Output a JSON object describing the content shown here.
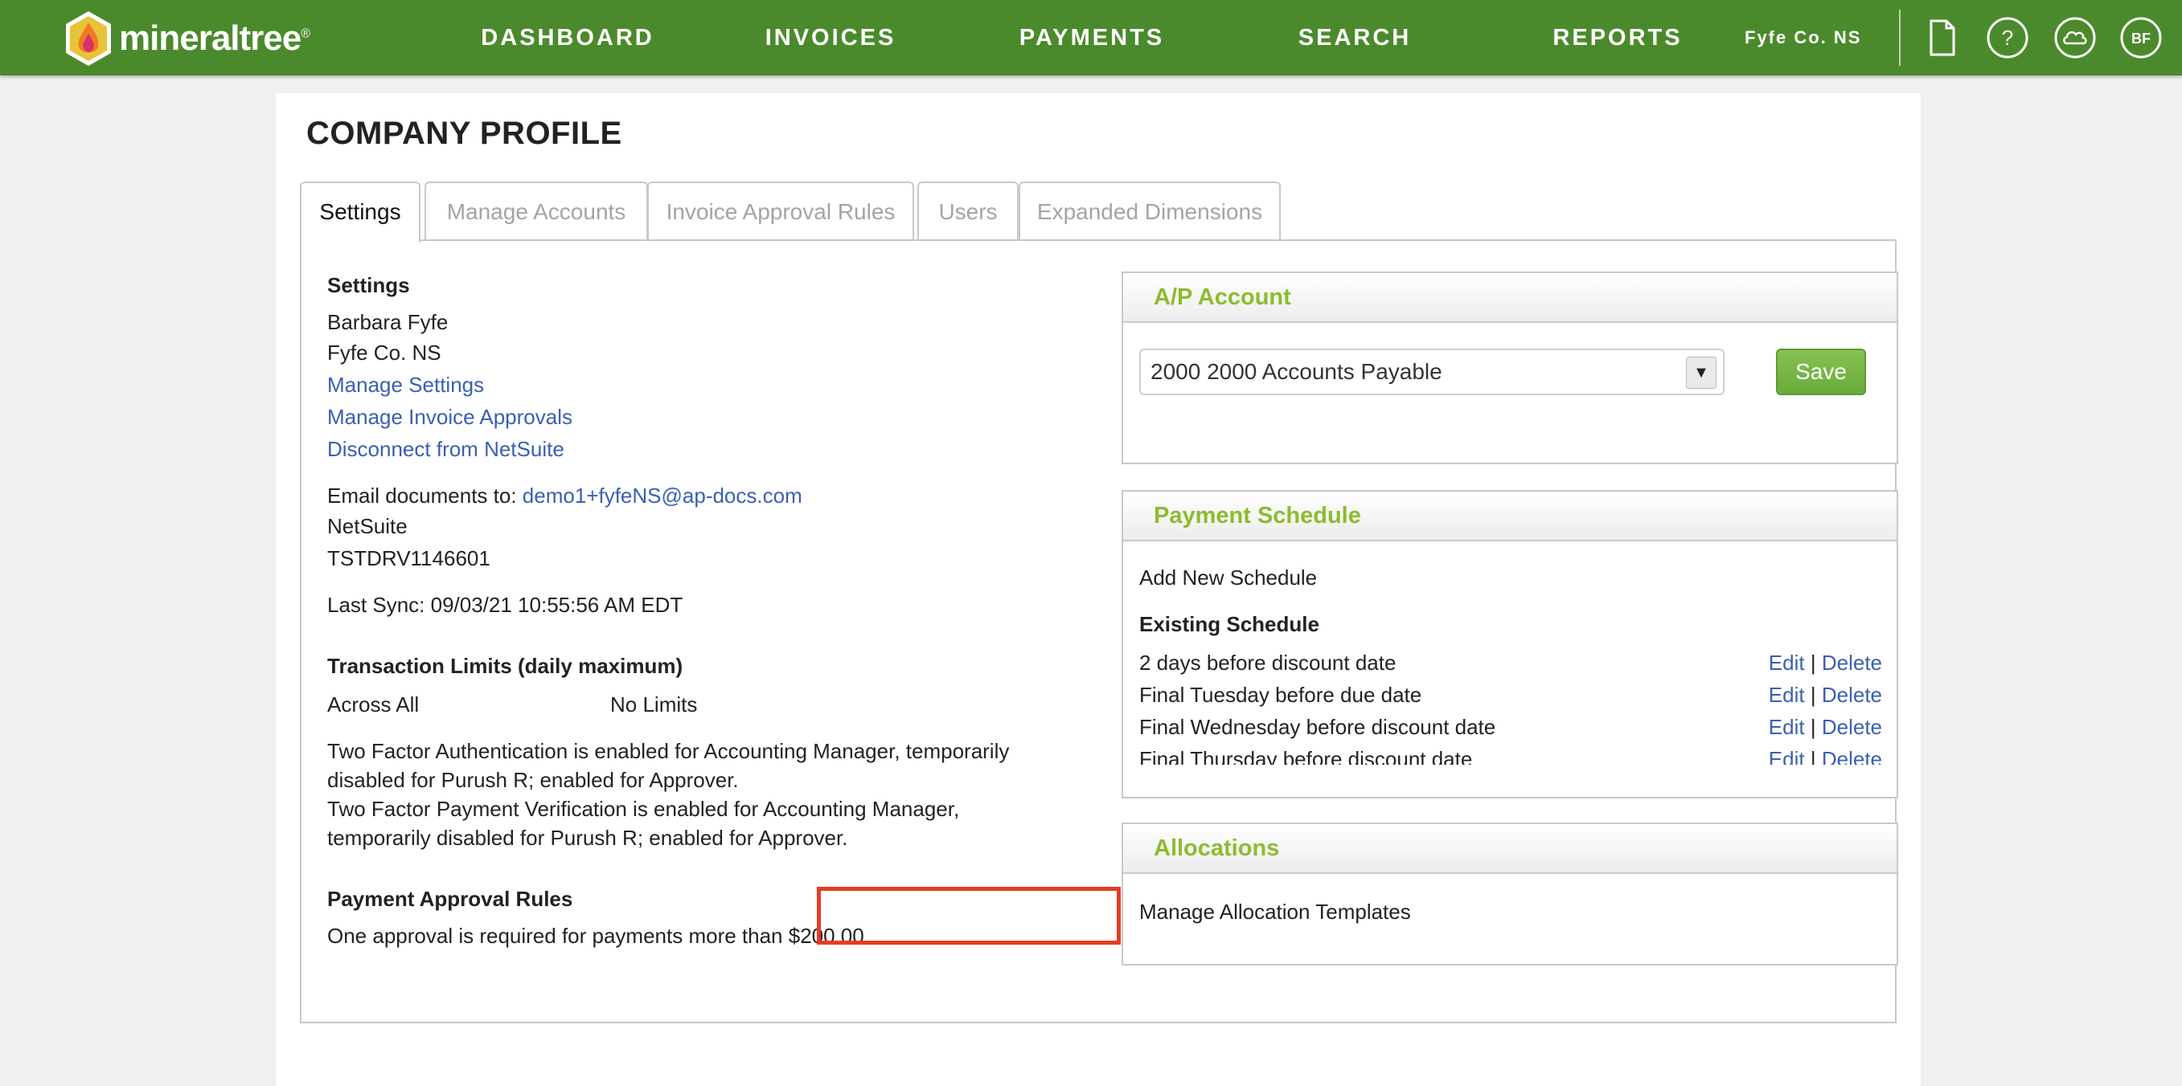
{
  "header": {
    "brand": "mineraltree",
    "brand_mark": "®",
    "nav": [
      "DASHBOARD",
      "INVOICES",
      "PAYMENTS",
      "SEARCH",
      "REPORTS"
    ],
    "company": "Fyfe Co. NS",
    "avatar_initials": "BF",
    "icons": [
      "document-icon",
      "help-icon",
      "cloud-icon",
      "avatar"
    ],
    "brand_color": "#4b8a2c"
  },
  "page": {
    "title": "COMPANY PROFILE",
    "tabs": [
      "Settings",
      "Manage Accounts",
      "Invoice Approval Rules",
      "Users",
      "Expanded Dimensions"
    ],
    "active_tab": "Settings"
  },
  "settings": {
    "heading": "Settings",
    "user_name": "Barbara Fyfe",
    "company": "Fyfe Co. NS",
    "links": [
      "Manage Settings",
      "Manage Invoice Approvals",
      "Disconnect from NetSuite"
    ],
    "email_label": "Email documents to:",
    "email": "demo1+fyfeNS@ap-docs.com",
    "erp": "NetSuite",
    "account_id": "TSTDRV1146601",
    "last_sync": "Last Sync: 09/03/21 10:55:56 AM EDT",
    "limits_heading": "Transaction Limits (daily maximum)",
    "limits_label": "Across All",
    "limits_value": "No Limits",
    "two_factor_line1": "Two Factor Authentication is enabled for Accounting Manager, temporarily",
    "two_factor_line2": "disabled for Purush R; enabled for Approver.",
    "two_factor_line3": "Two Factor Payment Verification is enabled for Accounting Manager,",
    "two_factor_line4": "temporarily disabled for Purush R; enabled for Approver.",
    "approval_heading": "Payment Approval Rules",
    "approval_text": "One approval is required for payments more than $200.00."
  },
  "ap_account": {
    "heading": "A/P Account",
    "selected": "2000 2000 Accounts Payable",
    "save_label": "Save"
  },
  "payment_schedule": {
    "heading": "Payment Schedule",
    "add_link": "Add New Schedule",
    "existing_heading": "Existing Schedule",
    "edit_label": "Edit",
    "delete_label": "Delete",
    "separator": "|",
    "items": [
      "2 days before discount date",
      "Final Tuesday before due date",
      "Final Wednesday before discount date",
      "Final Thursday before discount date"
    ]
  },
  "allocations": {
    "heading": "Allocations",
    "link": "Manage Allocation Templates"
  }
}
